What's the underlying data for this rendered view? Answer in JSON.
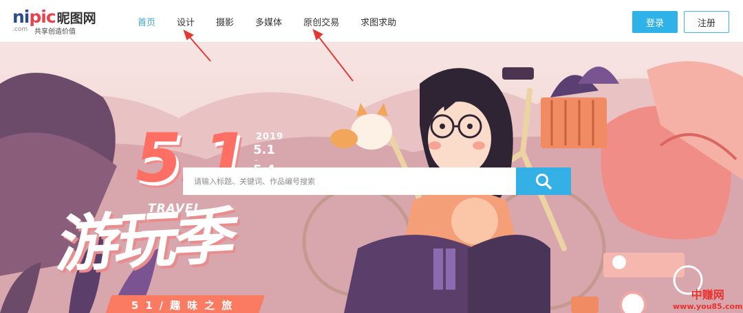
{
  "logo": {
    "brand_ni": "ni",
    "brand_pic": "pic",
    "brand_cn": "昵图网",
    "com": ".com",
    "slogan": "共享创造价值"
  },
  "nav": {
    "items": [
      {
        "label": "首页",
        "active": true
      },
      {
        "label": "设计"
      },
      {
        "label": "摄影"
      },
      {
        "label": "多媒体"
      },
      {
        "label": "原创交易"
      },
      {
        "label": "求图求助"
      }
    ]
  },
  "auth": {
    "login_label": "登录",
    "register_label": "注册"
  },
  "banner": {
    "big_number": "5.1",
    "year": "2019",
    "date_start": "5.1",
    "date_sep": "-",
    "date_end": "5.4",
    "travel": "TRAVEL",
    "headline": "游玩季",
    "tagline": "51/趣味之旅"
  },
  "search": {
    "placeholder": "请输入标题、关键词、作品编号搜索",
    "icon": "search-icon"
  },
  "watermark": {
    "cn": "中赚网",
    "url": "www.you85.com"
  },
  "colors": {
    "accent": "#2fb2e8",
    "active_nav": "#3fa6d8",
    "arrow": "#e53935",
    "promo_coral": "#ff6f63"
  }
}
